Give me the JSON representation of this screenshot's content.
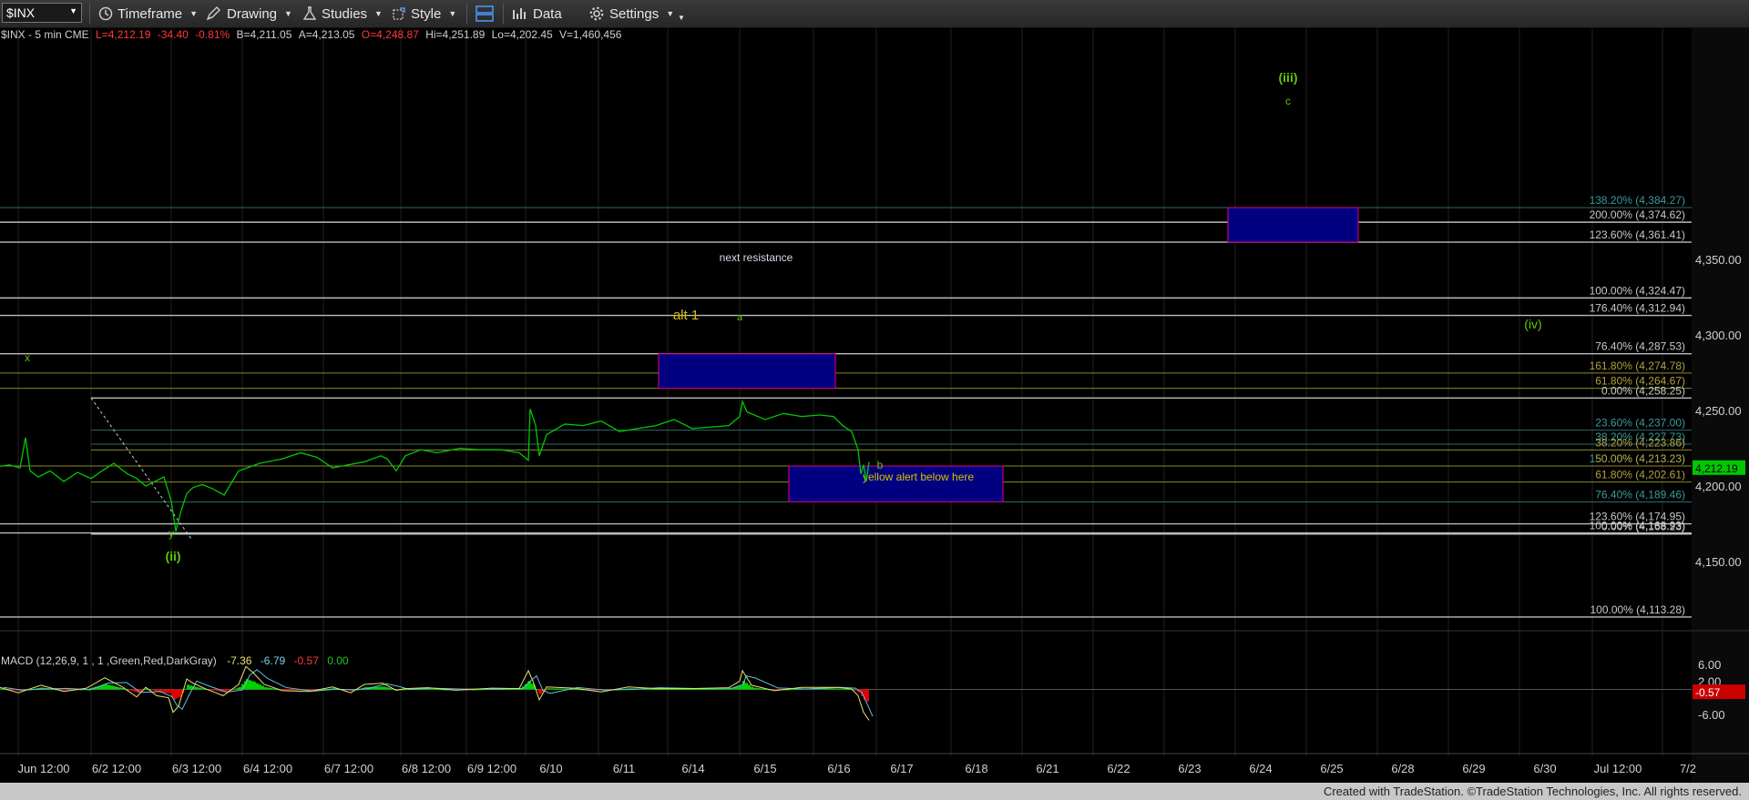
{
  "toolbar": {
    "symbol": "$INX",
    "timeframe": "Timeframe",
    "drawing": "Drawing",
    "studies": "Studies",
    "style": "Style",
    "data": "Data",
    "settings": "Settings"
  },
  "info": {
    "symbol_interval": "$INX - 5 min  CME",
    "last": "L=4,212.19",
    "change": "-34.40",
    "pct": "-0.81%",
    "bid": "B=4,211.05",
    "ask": "A=4,213.05",
    "open": "O=4,248.87",
    "high": "Hi=4,251.89",
    "low": "Lo=4,202.45",
    "volume": "V=1,460,456"
  },
  "macd": {
    "label": "MACD (12,26,9, 1 , 1 ,Green,Red,DarkGray)",
    "v1": "-7.36",
    "v2": "-6.79",
    "v3": "-0.57",
    "v4": "0.00",
    "axis": [
      "6.00",
      "2.00",
      "-6.00"
    ],
    "current": "-0.57"
  },
  "footer": "Created with TradeStation. ©TradeStation Technologies, Inc. All rights reserved.",
  "colors": {
    "up": "#00d000",
    "down": "#e00000",
    "price": "#00c800",
    "box": "#000080",
    "box_border": "#c0007a",
    "fib_white": "#bbbbbb",
    "fib_olive": "#8a8a2a",
    "fib_teal": "#2a6a6a",
    "accent_green": "#5cc800",
    "label_yellow": "#d8c000"
  },
  "chart_data": {
    "type": "line",
    "title": "",
    "ylabel": "",
    "ylim": [
      4110,
      4395
    ],
    "price_axis_ticks": [
      4150,
      4200,
      4250,
      4300,
      4350
    ],
    "price_axis_labels": [
      "4,150.00",
      "4,200.00",
      "4,250.00",
      "4,300.00",
      "4,350.00"
    ],
    "current_price": 4212.19,
    "current_price_label": "4,212.19",
    "time_axis_labels": [
      "Jun 12:00",
      "6/2 12:00",
      "6/3 12:00",
      "6/4 12:00",
      "6/7 12:00",
      "6/8 12:00",
      "6/9 12:00",
      "6/10",
      "6/11",
      "6/14",
      "6/15",
      "6/16",
      "6/17",
      "6/18",
      "6/21",
      "6/22",
      "6/23",
      "6/24",
      "6/25",
      "6/28",
      "6/29",
      "6/30",
      "Jul 12:00",
      "7/2"
    ],
    "price_series": [
      [
        0,
        4213
      ],
      [
        10,
        4214
      ],
      [
        22,
        4212
      ],
      [
        28,
        4232
      ],
      [
        33,
        4210
      ],
      [
        42,
        4206
      ],
      [
        55,
        4210
      ],
      [
        70,
        4203
      ],
      [
        85,
        4209
      ],
      [
        100,
        4205
      ],
      [
        112,
        4210
      ],
      [
        125,
        4215
      ],
      [
        140,
        4208
      ],
      [
        150,
        4205
      ],
      [
        160,
        4200
      ],
      [
        170,
        4203
      ],
      [
        180,
        4206
      ],
      [
        188,
        4190
      ],
      [
        193,
        4170
      ],
      [
        198,
        4182
      ],
      [
        205,
        4195
      ],
      [
        212,
        4199
      ],
      [
        222,
        4201
      ],
      [
        234,
        4198
      ],
      [
        246,
        4194
      ],
      [
        262,
        4210
      ],
      [
        285,
        4215
      ],
      [
        310,
        4218
      ],
      [
        330,
        4222
      ],
      [
        348,
        4219
      ],
      [
        365,
        4212
      ],
      [
        382,
        4214
      ],
      [
        400,
        4216
      ],
      [
        418,
        4220
      ],
      [
        425,
        4218
      ],
      [
        435,
        4210
      ],
      [
        445,
        4220
      ],
      [
        462,
        4224
      ],
      [
        480,
        4222
      ],
      [
        505,
        4225
      ],
      [
        525,
        4224
      ],
      [
        550,
        4224
      ],
      [
        570,
        4222
      ],
      [
        580,
        4217
      ],
      [
        582,
        4251
      ],
      [
        588,
        4240
      ],
      [
        592,
        4220
      ],
      [
        600,
        4234
      ],
      [
        620,
        4241
      ],
      [
        640,
        4240
      ],
      [
        660,
        4243
      ],
      [
        680,
        4236
      ],
      [
        700,
        4238
      ],
      [
        720,
        4240
      ],
      [
        740,
        4244
      ],
      [
        760,
        4238
      ],
      [
        780,
        4239
      ],
      [
        800,
        4240
      ],
      [
        812,
        4246
      ],
      [
        815,
        4256
      ],
      [
        820,
        4249
      ],
      [
        840,
        4244
      ],
      [
        860,
        4248
      ],
      [
        880,
        4246
      ],
      [
        900,
        4247
      ],
      [
        915,
        4246
      ],
      [
        925,
        4240
      ],
      [
        935,
        4236
      ],
      [
        942,
        4224
      ],
      [
        945,
        4208
      ],
      [
        948,
        4214
      ],
      [
        951,
        4203
      ],
      [
        954,
        4216
      ]
    ],
    "fib_levels": [
      {
        "label": "138.20% (4,384.27)",
        "value": 4384.27,
        "color": "teal"
      },
      {
        "label": "200.00% (4,374.62)",
        "value": 4374.62,
        "color": "white"
      },
      {
        "label": "123.60% (4,361.41)",
        "value": 4361.41,
        "color": "white"
      },
      {
        "label": "100.00% (4,324.47)",
        "value": 4324.47,
        "color": "white"
      },
      {
        "label": "176.40% (4,312.94)",
        "value": 4312.94,
        "color": "white"
      },
      {
        "label": "76.40% (4,287.53)",
        "value": 4287.53,
        "color": "white"
      },
      {
        "label": "161.80% (4,274.78)",
        "value": 4274.78,
        "color": "olive"
      },
      {
        "label": "61.80% (4,264.67)",
        "value": 4264.67,
        "color": "olive"
      },
      {
        "label": "0.00% (4,258.25)",
        "value": 4258.25,
        "color": "white"
      },
      {
        "label": "23.60% (4,237.00)",
        "value": 4237.0,
        "color": "teal"
      },
      {
        "label": "38.20% (4,227.73)",
        "value": 4227.73,
        "color": "teal"
      },
      {
        "label": "38.20% (4,223.86)",
        "value": 4223.86,
        "color": "olive"
      },
      {
        "label": "150.00% (4,213.23)",
        "value": 4213.23,
        "color": "teal"
      },
      {
        "label": "50.00% (4,213.23)",
        "value": 4213.23,
        "color": "olive"
      },
      {
        "label": "61.80% (4,202.61)",
        "value": 4202.61,
        "color": "olive"
      },
      {
        "label": "76.40% (4,189.46)",
        "value": 4189.46,
        "color": "teal"
      },
      {
        "label": "123.60% (4,174.95)",
        "value": 4174.95,
        "color": "white"
      },
      {
        "label": "100.00% (4,168.93)",
        "value": 4168.93,
        "color": "white"
      },
      {
        "label": "0.00% (4,168.23)",
        "value": 4168.23,
        "color": "white"
      },
      {
        "label": "100.00% (4,113.28)",
        "value": 4113.28,
        "color": "white"
      }
    ],
    "target_boxes": [
      {
        "name": "next resistance",
        "label": "next resistance",
        "top": 4287.5,
        "bottom": 4264.7
      },
      {
        "name": "b target",
        "label": "yellow alert below here",
        "top": 4213.2,
        "bottom": 4189.5
      },
      {
        "name": "iii target",
        "label": "",
        "top": 4384.3,
        "bottom": 4361.4
      }
    ],
    "wave_labels": [
      "x",
      "y",
      "(ii)",
      "alt 1",
      "a",
      "b",
      "(iii)",
      "c",
      "(iv)"
    ],
    "macd_series": [
      [
        0,
        0.5
      ],
      [
        20,
        -0.8
      ],
      [
        45,
        1.0
      ],
      [
        70,
        -0.5
      ],
      [
        95,
        0.3
      ],
      [
        115,
        2.8
      ],
      [
        135,
        0.5
      ],
      [
        150,
        -1.8
      ],
      [
        160,
        0.5
      ],
      [
        172,
        -1.5
      ],
      [
        185,
        -2.0
      ],
      [
        190,
        -5.5
      ],
      [
        196,
        -4.0
      ],
      [
        205,
        2.5
      ],
      [
        212,
        1.5
      ],
      [
        225,
        0.2
      ],
      [
        245,
        -1.5
      ],
      [
        262,
        1.2
      ],
      [
        270,
        5.5
      ],
      [
        278,
        4.0
      ],
      [
        290,
        1.2
      ],
      [
        310,
        -0.3
      ],
      [
        340,
        -0.5
      ],
      [
        365,
        0.6
      ],
      [
        385,
        -0.8
      ],
      [
        400,
        1.2
      ],
      [
        420,
        1.5
      ],
      [
        435,
        -0.2
      ],
      [
        445,
        0.2
      ],
      [
        470,
        0.4
      ],
      [
        500,
        -0.2
      ],
      [
        540,
        0.3
      ],
      [
        570,
        0.2
      ],
      [
        580,
        4.5
      ],
      [
        585,
        2.0
      ],
      [
        592,
        -2.5
      ],
      [
        600,
        0.6
      ],
      [
        630,
        0.3
      ],
      [
        660,
        -0.6
      ],
      [
        690,
        0.6
      ],
      [
        720,
        0.2
      ],
      [
        760,
        0.2
      ],
      [
        800,
        0.4
      ],
      [
        812,
        2.0
      ],
      [
        815,
        4.5
      ],
      [
        825,
        1.0
      ],
      [
        850,
        -0.3
      ],
      [
        880,
        0.5
      ],
      [
        920,
        0.5
      ],
      [
        935,
        0.1
      ],
      [
        942,
        -1.5
      ],
      [
        948,
        -5.5
      ],
      [
        954,
        -7.4
      ]
    ]
  }
}
